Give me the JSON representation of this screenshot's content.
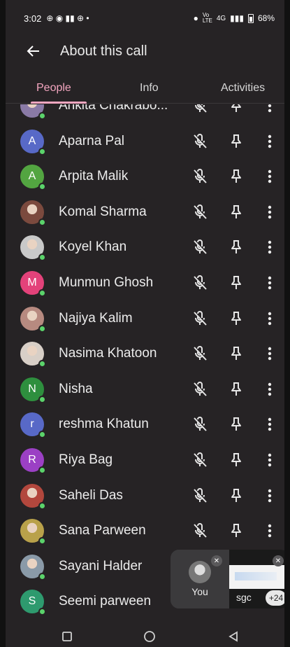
{
  "status_bar": {
    "time": "3:02",
    "network": "4G",
    "volte": "Vo LTE",
    "battery": "68%"
  },
  "header": {
    "title": "About this call"
  },
  "tabs": [
    {
      "label": "People",
      "active": true
    },
    {
      "label": "Info",
      "active": false
    },
    {
      "label": "Activities",
      "active": false
    }
  ],
  "participants": [
    {
      "name": "Ankita Chakrabo...",
      "avatar_letter": "",
      "avatar_color": "#8a7aa6",
      "photo": true
    },
    {
      "name": "Aparna Pal",
      "avatar_letter": "A",
      "avatar_color": "#5869c7"
    },
    {
      "name": "Arpita Malik",
      "avatar_letter": "A",
      "avatar_color": "#53a541"
    },
    {
      "name": "Komal Sharma",
      "avatar_letter": "",
      "avatar_color": "#7b4a3e",
      "photo": true
    },
    {
      "name": "Koyel Khan",
      "avatar_letter": "",
      "avatar_color": "#c9c9c9",
      "photo": true
    },
    {
      "name": "Munmun Ghosh",
      "avatar_letter": "M",
      "avatar_color": "#e3427a"
    },
    {
      "name": "Najiya Kalim",
      "avatar_letter": "",
      "avatar_color": "#b78a80",
      "photo": true
    },
    {
      "name": "Nasima Khatoon",
      "avatar_letter": "",
      "avatar_color": "#d8cfc7",
      "photo": true
    },
    {
      "name": "Nisha",
      "avatar_letter": "N",
      "avatar_color": "#2e8f3e"
    },
    {
      "name": "reshma Khatun",
      "avatar_letter": "r",
      "avatar_color": "#5869c7"
    },
    {
      "name": "Riya Bag",
      "avatar_letter": "R",
      "avatar_color": "#9b40c4"
    },
    {
      "name": "Saheli Das",
      "avatar_letter": "",
      "avatar_color": "#b2473d",
      "photo": true
    },
    {
      "name": "Sana Parween",
      "avatar_letter": "",
      "avatar_color": "#b9a14a",
      "photo": true
    },
    {
      "name": "Sayani Halder",
      "avatar_letter": "",
      "avatar_color": "#8a9aa8",
      "photo": true
    },
    {
      "name": "Seemi parween",
      "avatar_letter": "S",
      "avatar_color": "#2e9a6e"
    }
  ],
  "pip": {
    "self_label": "You",
    "presenter_label": "sgc",
    "more_count": "+24"
  },
  "colors": {
    "accent": "#f4a6c0",
    "background": "#262325",
    "online_dot": "#5bd36b"
  }
}
